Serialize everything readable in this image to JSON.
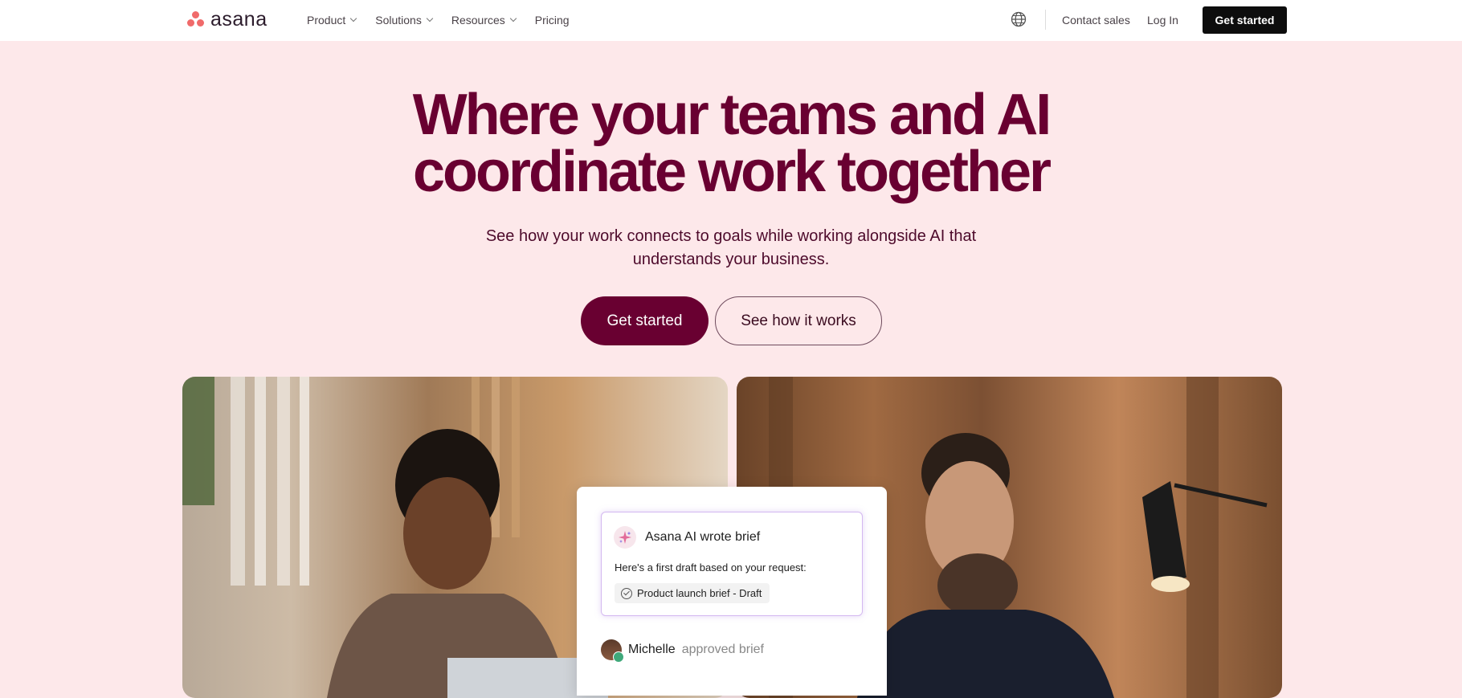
{
  "nav": {
    "brand": "asana",
    "links": [
      {
        "label": "Product",
        "dropdown": true
      },
      {
        "label": "Solutions",
        "dropdown": true
      },
      {
        "label": "Resources",
        "dropdown": true
      },
      {
        "label": "Pricing",
        "dropdown": false
      }
    ],
    "contact_sales": "Contact sales",
    "log_in": "Log In",
    "get_started": "Get started"
  },
  "hero": {
    "title_line1": "Where your teams and AI",
    "title_line2": "coordinate work together",
    "subtitle_line1": "See how your work connects to goals while working alongside AI that",
    "subtitle_line2": "understands your business.",
    "primary_cta": "Get started",
    "secondary_cta": "See how it works"
  },
  "card": {
    "brief_title": "Asana AI wrote brief",
    "brief_body": "Here's a first draft based on your request:",
    "chip_label": "Product launch brief - Draft",
    "approver_name": "Michelle",
    "approval_text": "approved brief"
  },
  "colors": {
    "hero_bg": "#fde8ea",
    "brand_plum": "#690031",
    "logo_coral": "#f06a6a"
  }
}
